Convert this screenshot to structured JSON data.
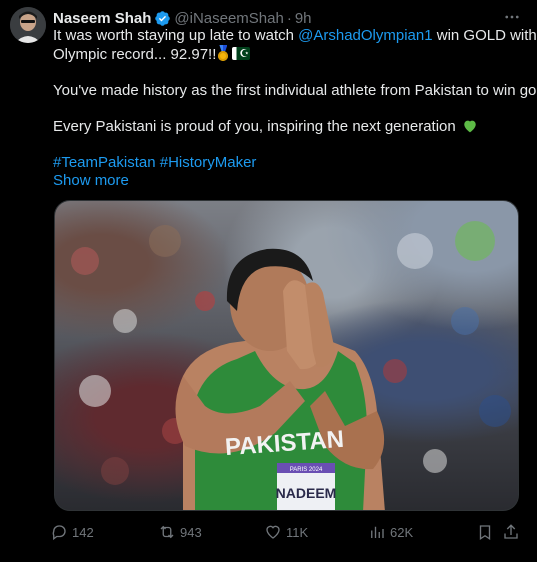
{
  "tweet": {
    "display_name": "Naseem Shah",
    "handle": "@iNaseemShah",
    "separator": "·",
    "time": "9h",
    "text": {
      "line1_pre": "It was worth staying up late to watch ",
      "mention": "@ArshadOlympian1",
      "line1_post": " win GOLD with an",
      "line2": "Olympic record... 92.97!!",
      "para2": "You've made history as the first individual athlete from Pakistan to win gold.",
      "para3": "Every Pakistani is proud of you, inspiring the next generation",
      "hashtag1": "#TeamPakistan",
      "hashtag2": "#HistoryMaker"
    },
    "show_more": "Show more",
    "media_jersey_text": "PAKISTAN",
    "media_bib_name": "NADEEM",
    "media_bib_small": "PARIS 2024"
  },
  "actions": {
    "replies": "142",
    "reposts": "943",
    "likes": "11K",
    "views": "62K"
  },
  "colors": {
    "background": "#000000",
    "text": "#e7e9ea",
    "muted": "#71767b",
    "link": "#1d9bf0",
    "verified": "#1d9bf0",
    "jersey": "#2e8b3a"
  }
}
